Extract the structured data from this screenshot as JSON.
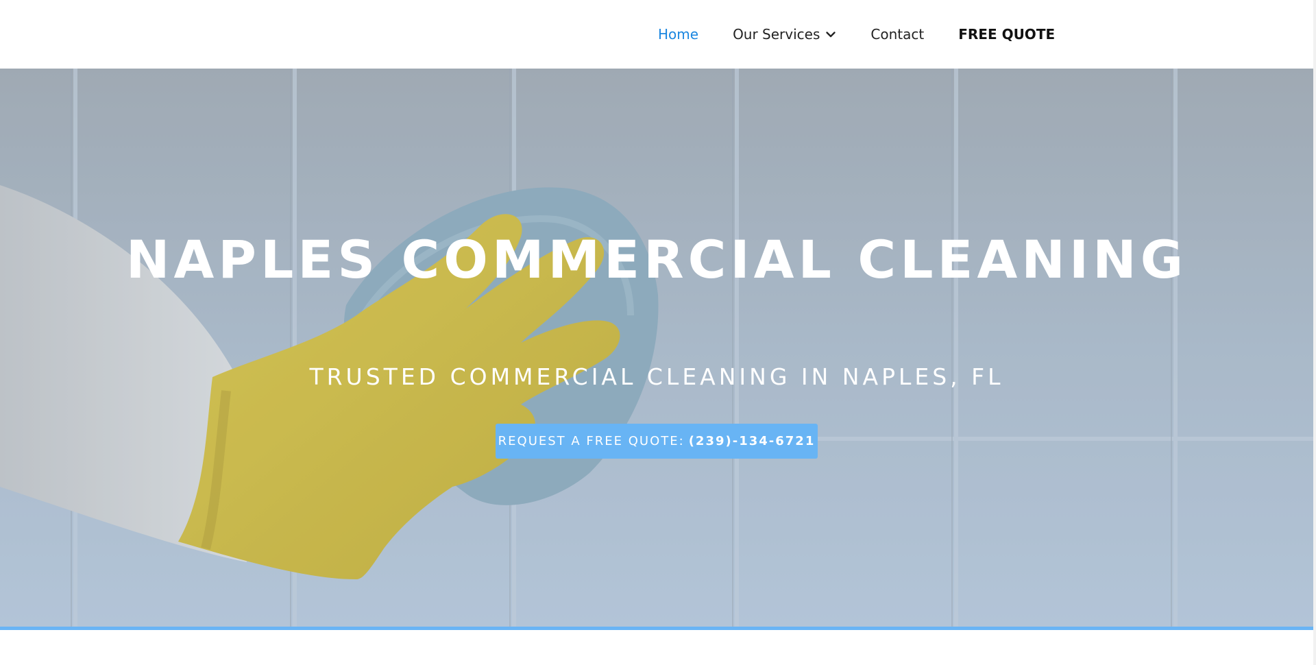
{
  "nav": {
    "items": [
      {
        "label": "Home",
        "active": true
      },
      {
        "label": "Our Services",
        "has_dropdown": true
      },
      {
        "label": "Contact"
      },
      {
        "label": "FREE QUOTE"
      }
    ]
  },
  "hero": {
    "title": "NAPLES COMMERCIAL CLEANING",
    "subtitle": "TRUSTED COMMERCIAL CLEANING IN NAPLES, FL",
    "button": {
      "label": "REQUEST A FREE QUOTE:",
      "phone": "(239)-134-6721"
    }
  },
  "colors": {
    "nav_active": "#1a86e0",
    "button_bg": "#68b4f4",
    "accent_bar": "#6ab4f5"
  },
  "icons": {
    "dropdown": "chevron-down-icon"
  }
}
